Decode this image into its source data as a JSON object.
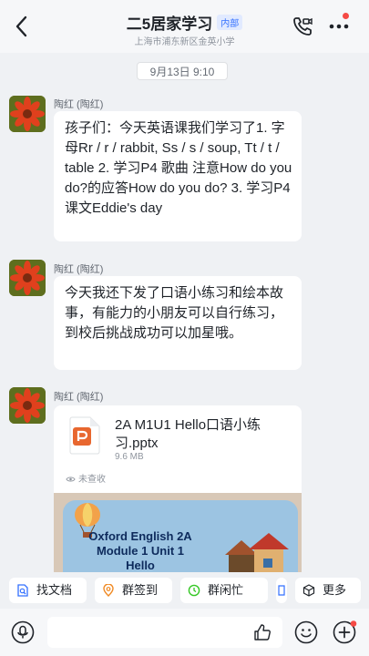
{
  "header": {
    "title": "二5居家学习",
    "tag": "内部",
    "subtitle": "上海市浦东新区金英小学",
    "back_icon": "chevron-left-icon",
    "call_icon": "phone-video-icon",
    "more_icon": "more-dots-icon"
  },
  "timestamp": "9月13日 9:10",
  "messages": [
    {
      "sender": "陶红 (陶红)",
      "text": "孩子们：今天英语课我们学习了1. 字母Rr / r / rabbit, Ss / s / soup, Tt / t / table  2. 学习P4 歌曲 注意How do you do?的应答How do you do? 3. 学习P4课文Eddie's day"
    },
    {
      "sender": "陶红 (陶红)",
      "text": "今天我还下发了口语小练习和绘本故事，有能力的小朋友可以自行练习，到校后挑战成功可以加星哦。"
    },
    {
      "sender": "陶红 (陶红)",
      "file": {
        "name": "2A M1U1 Hello口语小练习.pptx",
        "size": "9.6 MB",
        "status": "未查收",
        "preview_title": "Oxford English 2A Module 1 Unit 1 Hello"
      }
    }
  ],
  "quick_actions": [
    {
      "label": "找文档",
      "icon": "search-doc-icon"
    },
    {
      "label": "群签到",
      "icon": "location-pin-icon"
    },
    {
      "label": "群闲忙",
      "icon": "clock-icon"
    },
    {
      "label": "更多",
      "icon": "cube-icon"
    }
  ],
  "input_bar": {
    "voice_icon": "microphone-icon",
    "like_icon": "thumbs-up-icon",
    "emoji_icon": "smiley-icon",
    "plus_icon": "plus-circle-icon"
  },
  "colors": {
    "accent": "#3370ff",
    "badge_red": "#f54a45",
    "ppt_orange": "#e8672f",
    "background": "#eff1f4"
  }
}
